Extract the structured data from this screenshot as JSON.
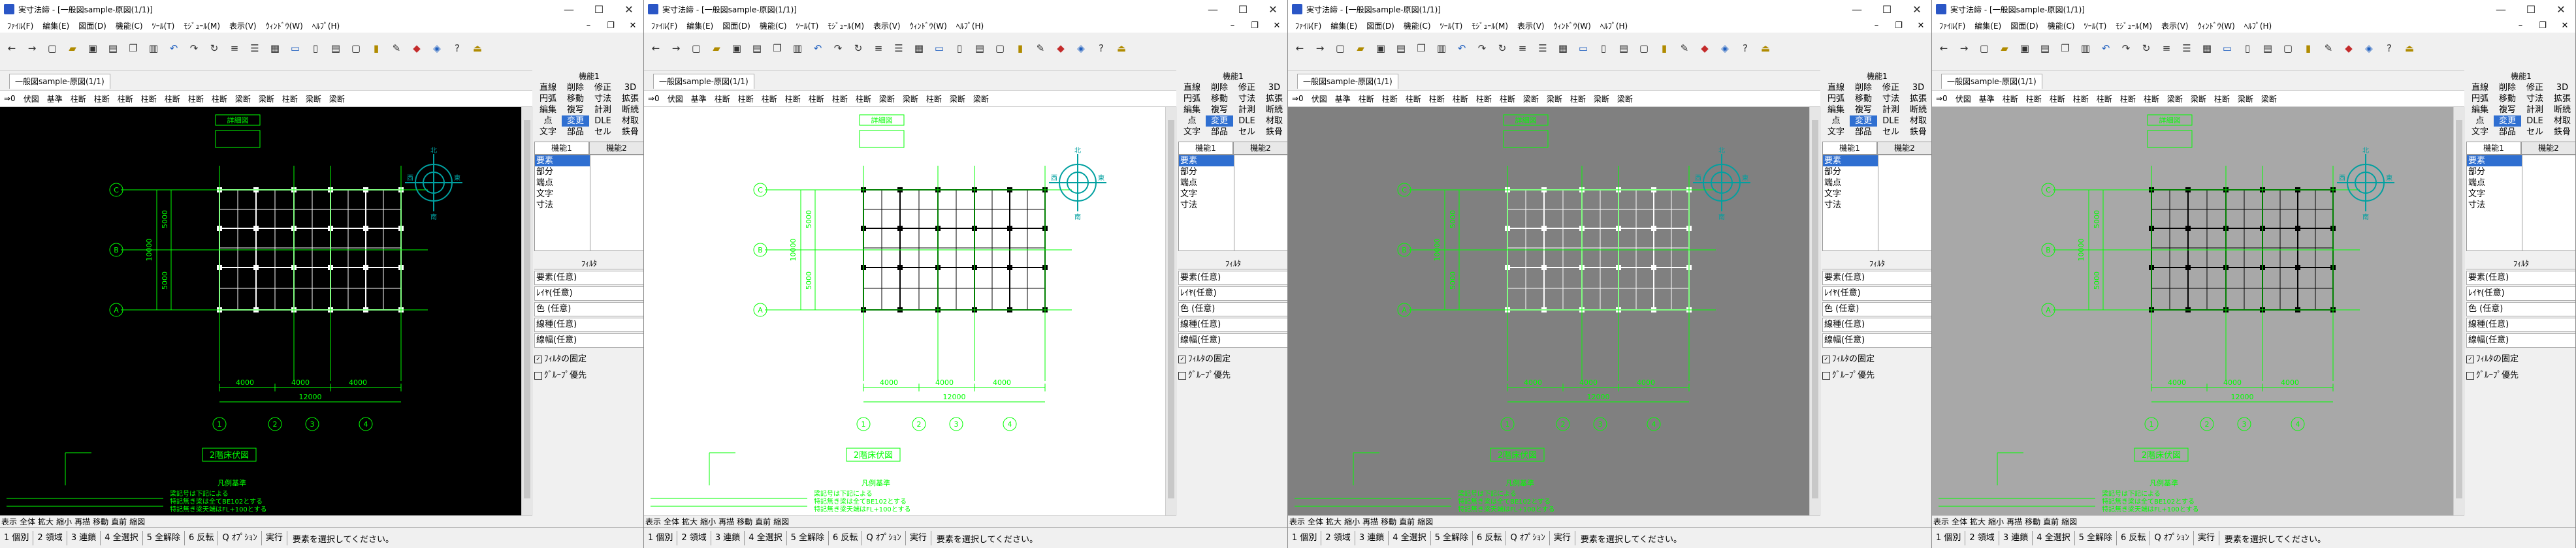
{
  "colors": {
    "drawing_green": "#00ff00",
    "drawing_teal": "#00a0a0",
    "highlight_blue": "#2f6fd1"
  },
  "app": {
    "title": "実寸法締 - [一般図sample-原図(1/1)]",
    "menus": [
      "ﾌｧｲﾙ(F)",
      "編集(E)",
      "図面(D)",
      "機能(C)",
      "ﾂｰﾙ(T)",
      "ﾓｼﾞｭｰﾙ(M)",
      "表示(V)",
      "ｳｨﾝﾄﾞｳ(W)",
      "ﾍﾙﾌﾟ(H)"
    ],
    "doc_tab": "一般図sample-原図(1/1)",
    "layer_bar": [
      "⇒0",
      "伏図",
      "基準",
      "柱断",
      "柱断",
      "柱断",
      "柱断",
      "柱断",
      "柱断",
      "柱断",
      "梁断",
      "梁断",
      "柱断",
      "梁断",
      "梁断"
    ],
    "panel": {
      "title": "機能1",
      "grid": [
        "直線",
        "削除",
        "修正",
        "3D",
        "円弧",
        "移動",
        "寸法",
        "拡張",
        "編集",
        "複写",
        "計測",
        "断続",
        "点",
        "変更",
        "DLE",
        "材取",
        "文字",
        "部品",
        "セル",
        "鉄骨"
      ],
      "grid_highlight": [
        13
      ],
      "tabs": [
        "機能1",
        "機能2"
      ],
      "list": [
        "要素",
        "部分",
        "端点",
        "文字",
        "寸法"
      ],
      "filter_title": "ﾌｨﾙﾀ",
      "filters": [
        "要素(任意)",
        "ﾚｲﾔ(任意)",
        "色 (任意)",
        "線種(任意)",
        "線幅(任意)"
      ],
      "fix_filter": "ﾌｨﾙﾀの固定",
      "group_priority": "ｸﾞﾙｰﾌﾟ優先"
    },
    "hscroll": [
      "表示",
      "全体",
      "拡大",
      "縮小",
      "再描",
      "移動",
      "直前",
      "縮図"
    ],
    "function_keys": [
      "1 個別",
      "2 領域",
      "3 連鎖",
      "4 全選択",
      "5 全解除",
      "6 反転",
      "Q ｵﾌﾟｼｮﾝ",
      "実行"
    ],
    "status": "要素を選択してください。",
    "drawing": {
      "title_label": "詳細図",
      "plan_label": "2階床伏図",
      "dim_total_y": "10000",
      "dim_y1": "5000",
      "dim_y2": "5000",
      "dim_x1": "4000",
      "dim_x2": "4000",
      "dim_x3": "4000",
      "dim_total_x": "12000",
      "axis_c": "C",
      "axis_b": "B",
      "axis_a": "A",
      "axis_1": "1",
      "axis_2": "2",
      "axis_3": "3",
      "axis_4": "4",
      "compass_n": "北",
      "compass_w": "西",
      "compass_e": "東",
      "compass_s": "南",
      "note_title": "凡例基準",
      "note_line1": "梁記号は下記による",
      "note_line2": "特記無き梁は全てBE102とする",
      "note_line3": "特記無き梁天端はFL+100とする"
    }
  },
  "windows": [
    {
      "background": "#000000",
      "lines": "#ffffff"
    },
    {
      "background": "#ffffff",
      "lines": "#000000"
    },
    {
      "background": "#808080",
      "lines": "#ffffff"
    },
    {
      "background": "#a8a8a8",
      "lines": "#000000"
    }
  ]
}
